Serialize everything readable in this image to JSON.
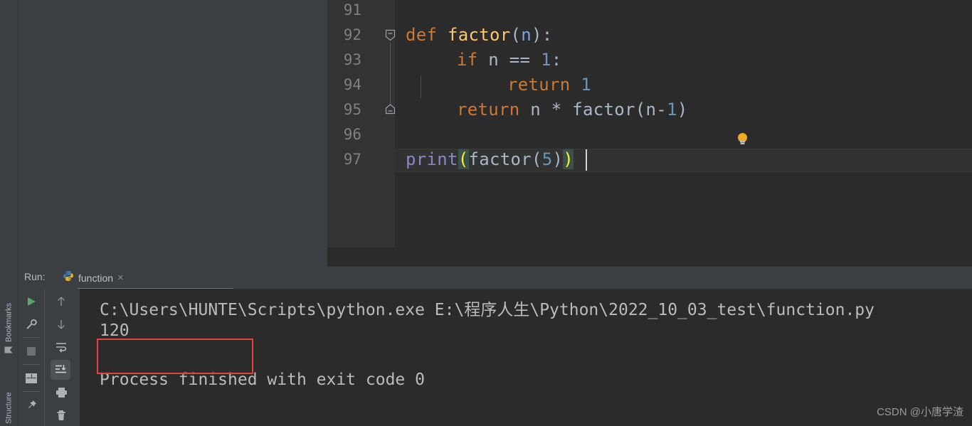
{
  "left_stripe": {
    "bookmarks": {
      "label": "Bookmarks",
      "icon": "bookmark-icon"
    },
    "structure": {
      "label": "Structure"
    }
  },
  "editor": {
    "line_numbers": [
      "91",
      "92",
      "93",
      "94",
      "95",
      "96",
      "97"
    ],
    "lines": [
      {
        "no": "91",
        "text": ""
      },
      {
        "no": "92",
        "text": "def factor(n):"
      },
      {
        "no": "93",
        "text": "    if n == 1:"
      },
      {
        "no": "94",
        "text": "        return 1"
      },
      {
        "no": "95",
        "text": "    return n * factor(n-1)"
      },
      {
        "no": "96",
        "text": ""
      },
      {
        "no": "97",
        "text": "print(factor(5))"
      }
    ],
    "tokens": {
      "l92_def": "def",
      "l92_name": "factor",
      "l92_open": "(",
      "l92_param": "n",
      "l92_close": ")",
      "l92_colon": ":",
      "l93_if": "if",
      "l93_n": "n",
      "l93_eq": "==",
      "l93_one": "1",
      "l93_colon": ":",
      "l94_return": "return",
      "l94_one": "1",
      "l95_return": "return",
      "l95_n": "n",
      "l95_star": "*",
      "l95_call": "factor",
      "l95_open": "(",
      "l95_arg": "n-",
      "l95_one": "1",
      "l95_close": ")",
      "l97_print": "print",
      "l97_open": "(",
      "l97_call": "factor",
      "l97_open2": "(",
      "l97_five": "5",
      "l97_close2": ")",
      "l97_close": ")"
    },
    "fold_markers": [
      "fold-collapse-start-icon",
      "fold-collapse-end-icon"
    ],
    "bulb": "intention-bulb-icon"
  },
  "run_window": {
    "label": "Run:",
    "tab": {
      "label": "function",
      "icon": "python-file-icon",
      "close": "×"
    },
    "toolbar_left": [
      {
        "name": "rerun-button",
        "icon": "play-icon"
      },
      {
        "name": "edit-configurations-button",
        "icon": "wrench-icon"
      },
      {
        "name": "stop-button",
        "icon": "stop-square-icon"
      },
      {
        "name": "layout-settings-button",
        "icon": "layout-icon"
      },
      {
        "name": "pin-tab-button",
        "icon": "pin-icon"
      }
    ],
    "toolbar_right": [
      {
        "name": "up-the-stack-trace-button",
        "icon": "arrow-up-icon"
      },
      {
        "name": "down-the-stack-trace-button",
        "icon": "arrow-down-icon"
      },
      {
        "name": "soft-wrap-button",
        "icon": "soft-wrap-icon"
      },
      {
        "name": "scroll-to-end-button",
        "icon": "scroll-to-end-icon",
        "active": true
      },
      {
        "name": "print-button",
        "icon": "printer-icon"
      },
      {
        "name": "clear-all-button",
        "icon": "trash-icon"
      }
    ],
    "console": {
      "command": "C:\\Users\\HUNTE\\Scripts\\python.exe E:\\程序人生\\Python\\2022_10_03_test\\function.py",
      "output": "120",
      "exit_message": "Process finished with exit code 0"
    },
    "highlight_box_color": "#e64040"
  },
  "watermark": "CSDN @小唐学渣",
  "colors": {
    "editor_bg": "#2b2b2b",
    "panel_bg": "#3c3f41",
    "gutter_bg": "#313335",
    "keyword": "#cc7832",
    "function_name": "#ffc66d",
    "number": "#6897bb",
    "builtin": "#8888c6",
    "text": "#a9b7c6",
    "line_number": "#808080",
    "highlight_red": "#e64040",
    "bulb_amber": "#f5a623",
    "matched_paren": "#ffef28"
  }
}
